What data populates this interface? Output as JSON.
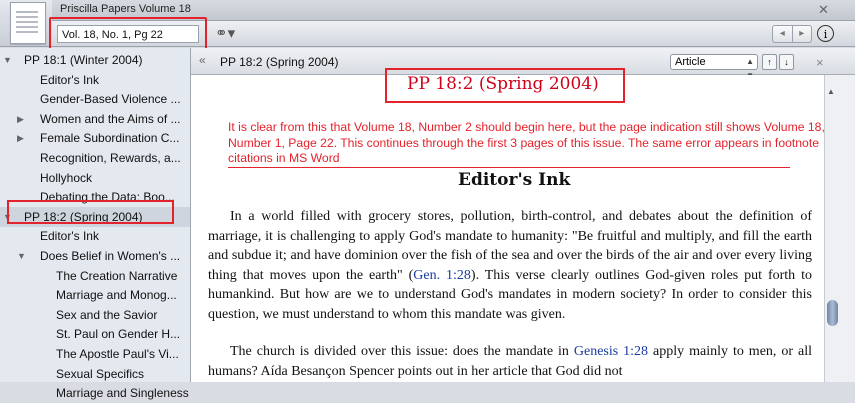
{
  "window": {
    "tab_title": "Priscilla Papers Volume 18"
  },
  "toolbar": {
    "reference_input": "Vol. 18, No. 1, Pg 22",
    "info_label": "i",
    "back_label": "◀",
    "forward_label": "▶"
  },
  "sidebar": {
    "items": [
      {
        "label": "PP 18:1 (Winter 2004)",
        "level": 0,
        "expanded": true
      },
      {
        "label": "Editor's Ink",
        "level": 1
      },
      {
        "label": "Gender-Based Violence ...",
        "level": 1
      },
      {
        "label": "Women and the Aims of ...",
        "level": 1,
        "collapsed": true
      },
      {
        "label": "Female Subordination C...",
        "level": 1,
        "collapsed": true
      },
      {
        "label": "Recognition, Rewards, a...",
        "level": 1
      },
      {
        "label": "Hollyhock",
        "level": 1
      },
      {
        "label": "Debating the Data: Boo...",
        "level": 1
      },
      {
        "label": "PP 18:2 (Spring 2004)",
        "level": 0,
        "expanded": true,
        "selected": true
      },
      {
        "label": "Editor's Ink",
        "level": 1
      },
      {
        "label": "Does Belief in Women's ...",
        "level": 1,
        "expanded": true
      },
      {
        "label": "The Creation Narrative",
        "level": 2
      },
      {
        "label": "Marriage and Monog...",
        "level": 2
      },
      {
        "label": "Sex and the Savior",
        "level": 2
      },
      {
        "label": "St. Paul on Gender H...",
        "level": 2
      },
      {
        "label": "The Apostle Paul's Vi...",
        "level": 2
      },
      {
        "label": "Sexual Specifics",
        "level": 2
      },
      {
        "label": "Marriage and Singleness",
        "level": 2
      }
    ]
  },
  "content_header": {
    "title": "PP 18:2 (Spring 2004)",
    "collapse_glyph": "«",
    "view_select": "Article",
    "up_label": "↑",
    "down_label": "↓",
    "close_label": "×"
  },
  "article": {
    "annotation_heading": "PP 18:2 (Spring 2004)",
    "annotation_note": "It is clear from this that Volume 18, Number 2 should begin here, but the page indication still shows Volume 18, Number 1, Page 22. This continues through the first 3 pages of this issue. The same error appears in footnote citations in MS Word",
    "section_title": "Editor's Ink",
    "p1_before": "In a world filled with grocery stores, pollution, birth-control, and debates about the definition of marriage, it is challenging to apply God's mandate to humanity: \"Be fruitful and multiply, and fill the earth and subdue it; and have dominion over the fish of the sea and over the birds of the air and over every living thing that moves upon the earth\" (",
    "p1_ref": "Gen. 1:28",
    "p1_after": "). This verse clearly outlines God-given roles put forth to humankind. But how are we to understand God's mandates in modern society? In order to consider this question, we must understand to whom this mandate was given.",
    "p2_before": "The church is divided over this issue: does the mandate in ",
    "p2_ref": "Genesis 1:28",
    "p2_after": " apply mainly to men, or all humans? Aída Besançon Spencer points out in her article that God did not"
  },
  "colors": {
    "annotation_red": "#e3232c",
    "link_blue": "#1a3ca0",
    "sidebar_bg": "#e4e8ef"
  }
}
